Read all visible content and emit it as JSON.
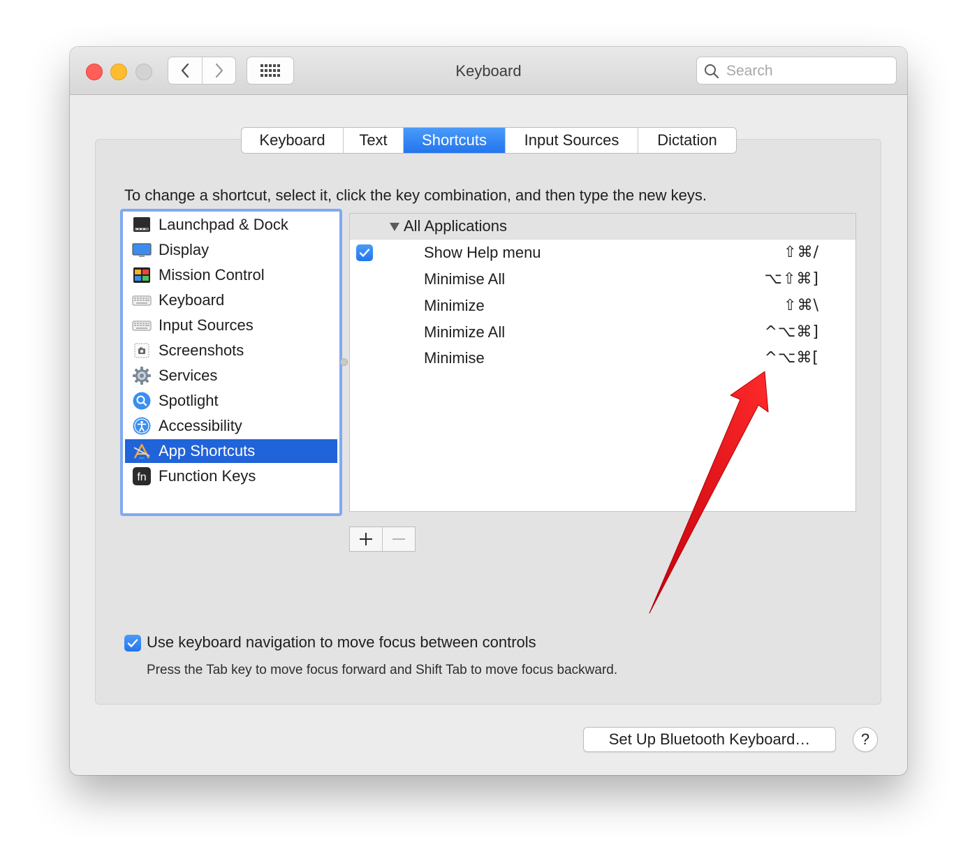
{
  "window": {
    "title": "Keyboard",
    "search_placeholder": "Search"
  },
  "tabs": [
    {
      "label": "Keyboard",
      "active": false
    },
    {
      "label": "Text",
      "active": false
    },
    {
      "label": "Shortcuts",
      "active": true
    },
    {
      "label": "Input Sources",
      "active": false
    },
    {
      "label": "Dictation",
      "active": false
    }
  ],
  "instruction": "To change a shortcut, select it, click the key combination, and then type the new keys.",
  "sidebar": {
    "items": [
      {
        "label": "Launchpad & Dock",
        "icon": "launchpad-dock-icon"
      },
      {
        "label": "Display",
        "icon": "display-icon"
      },
      {
        "label": "Mission Control",
        "icon": "mission-control-icon"
      },
      {
        "label": "Keyboard",
        "icon": "keyboard-icon"
      },
      {
        "label": "Input Sources",
        "icon": "input-sources-icon"
      },
      {
        "label": "Screenshots",
        "icon": "screenshots-icon"
      },
      {
        "label": "Services",
        "icon": "gear-icon"
      },
      {
        "label": "Spotlight",
        "icon": "spotlight-icon"
      },
      {
        "label": "Accessibility",
        "icon": "accessibility-icon"
      },
      {
        "label": "App Shortcuts",
        "icon": "app-shortcuts-icon",
        "selected": true
      },
      {
        "label": "Function Keys",
        "icon": "fn-key-icon",
        "icon_text": "fn"
      }
    ]
  },
  "shortcuts": {
    "group": "All Applications",
    "rows": [
      {
        "name": "Show Help menu",
        "keys": "⇧⌘/",
        "checked": true
      },
      {
        "name": "Minimise All",
        "keys": "⌥⇧⌘]",
        "checked": false
      },
      {
        "name": "Minimize",
        "keys": "⇧⌘\\",
        "checked": false
      },
      {
        "name": "Minimize All",
        "keys": "^⌥⌘]",
        "checked": false
      },
      {
        "name": "Minimise",
        "keys": "^⌥⌘[",
        "checked": false
      }
    ]
  },
  "navigation": {
    "checked": true,
    "label": "Use keyboard navigation to move focus between controls",
    "hint": "Press the Tab key to move focus forward and Shift Tab to move focus backward."
  },
  "buttons": {
    "bluetooth": "Set Up Bluetooth Keyboard…",
    "help": "?"
  },
  "colors": {
    "accent": "#2375ee",
    "selection": "#2163d8",
    "focus_ring": "#7eaaf2",
    "annotation_arrow": "#e8101a"
  }
}
